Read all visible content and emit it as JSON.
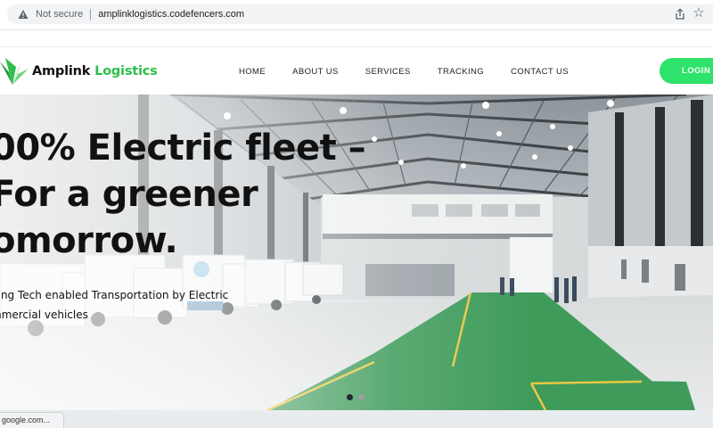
{
  "browser": {
    "security_label": "Not secure",
    "url": "amplinklogistics.codefencers.com",
    "status_url": "google.com..."
  },
  "logo": {
    "word1": "Amplink",
    "word2": "Logistics",
    "brand_green": "#2fbf4a"
  },
  "nav": {
    "items": [
      {
        "label": "HOME"
      },
      {
        "label": "ABOUT US"
      },
      {
        "label": "SERVICES"
      },
      {
        "label": "TRACKING"
      },
      {
        "label": "CONTACT US"
      }
    ],
    "login_label": "LOGIN",
    "login_color": "#2ee36b"
  },
  "hero": {
    "title_lines": [
      "00% Electric fleet –",
      "For a greener",
      "omorrow."
    ],
    "subtitle_lines": [
      "ding Tech enabled Transportation by Electric",
      "mmercial vehicles"
    ],
    "slides_total": 2,
    "active_slide": 1
  },
  "icons": {
    "security": "warning-triangle-icon",
    "share": "share-icon",
    "bookmark": "star-icon"
  }
}
